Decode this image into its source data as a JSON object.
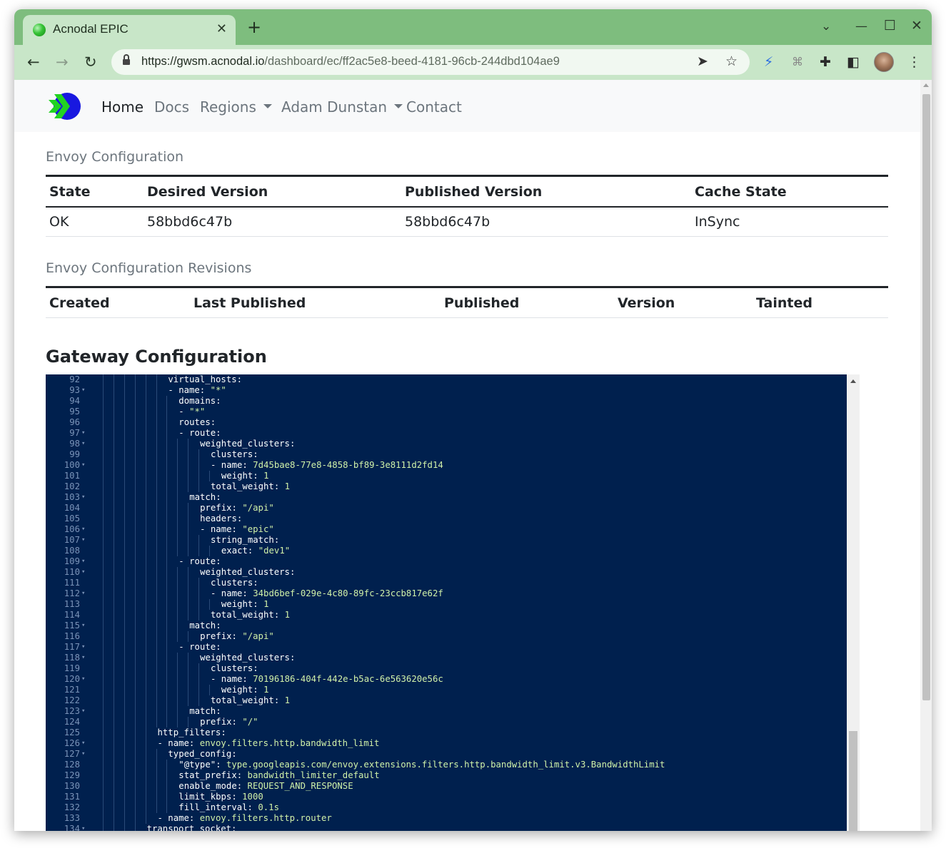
{
  "browser": {
    "tab_title": "Acnodal EPIC",
    "url_scheme_host": "https://gwsm.acnodal.io",
    "url_path": "/dashboard/ec/ff2ac5e8-beed-4181-96cb-244dbd104ae9"
  },
  "nav": {
    "home": "Home",
    "docs": "Docs",
    "regions": "Regions",
    "user": "Adam Dunstan",
    "contact": "Contact"
  },
  "envoy_config": {
    "title": "Envoy Configuration",
    "headers": [
      "State",
      "Desired Version",
      "Published Version",
      "Cache State"
    ],
    "row": [
      "OK",
      "58bbd6c47b",
      "58bbd6c47b",
      "InSync"
    ]
  },
  "revisions": {
    "title": "Envoy Configuration Revisions",
    "headers": [
      "Created",
      "Last Published",
      "Published",
      "Version",
      "Tainted"
    ]
  },
  "gateway": {
    "title": "Gateway Configuration",
    "lines": [
      {
        "n": "92",
        "fold": false,
        "indent": 12,
        "key": "virtual_hosts:",
        "val": ""
      },
      {
        "n": "93",
        "fold": true,
        "indent": 12,
        "key": "- name: ",
        "val": "\"*\""
      },
      {
        "n": "94",
        "fold": false,
        "indent": 14,
        "key": "domains:",
        "val": ""
      },
      {
        "n": "95",
        "fold": false,
        "indent": 14,
        "key": "- ",
        "val": "\"*\""
      },
      {
        "n": "96",
        "fold": false,
        "indent": 14,
        "key": "routes:",
        "val": ""
      },
      {
        "n": "97",
        "fold": true,
        "indent": 14,
        "key": "- route:",
        "val": ""
      },
      {
        "n": "98",
        "fold": true,
        "indent": 18,
        "key": "weighted_clusters:",
        "val": ""
      },
      {
        "n": "99",
        "fold": false,
        "indent": 20,
        "key": "clusters:",
        "val": ""
      },
      {
        "n": "100",
        "fold": true,
        "indent": 20,
        "key": "- name: ",
        "val": "7d45bae8-77e8-4858-bf89-3e8111d2fd14"
      },
      {
        "n": "101",
        "fold": false,
        "indent": 22,
        "key": "weight: ",
        "val": "1"
      },
      {
        "n": "102",
        "fold": false,
        "indent": 20,
        "key": "total_weight: ",
        "val": "1"
      },
      {
        "n": "103",
        "fold": true,
        "indent": 16,
        "key": "match:",
        "val": ""
      },
      {
        "n": "104",
        "fold": false,
        "indent": 18,
        "key": "prefix: ",
        "val": "\"/api\""
      },
      {
        "n": "105",
        "fold": false,
        "indent": 18,
        "key": "headers:",
        "val": ""
      },
      {
        "n": "106",
        "fold": true,
        "indent": 18,
        "key": "- name: ",
        "val": "\"epic\""
      },
      {
        "n": "107",
        "fold": true,
        "indent": 20,
        "key": "string_match:",
        "val": ""
      },
      {
        "n": "108",
        "fold": false,
        "indent": 22,
        "key": "exact: ",
        "val": "\"dev1\""
      },
      {
        "n": "109",
        "fold": true,
        "indent": 14,
        "key": "- route:",
        "val": ""
      },
      {
        "n": "110",
        "fold": true,
        "indent": 18,
        "key": "weighted_clusters:",
        "val": ""
      },
      {
        "n": "111",
        "fold": false,
        "indent": 20,
        "key": "clusters:",
        "val": ""
      },
      {
        "n": "112",
        "fold": true,
        "indent": 20,
        "key": "- name: ",
        "val": "34bd6bef-029e-4c80-89fc-23ccb817e62f"
      },
      {
        "n": "113",
        "fold": false,
        "indent": 22,
        "key": "weight: ",
        "val": "1"
      },
      {
        "n": "114",
        "fold": false,
        "indent": 20,
        "key": "total_weight: ",
        "val": "1"
      },
      {
        "n": "115",
        "fold": true,
        "indent": 16,
        "key": "match:",
        "val": ""
      },
      {
        "n": "116",
        "fold": false,
        "indent": 18,
        "key": "prefix: ",
        "val": "\"/api\""
      },
      {
        "n": "117",
        "fold": true,
        "indent": 14,
        "key": "- route:",
        "val": ""
      },
      {
        "n": "118",
        "fold": true,
        "indent": 18,
        "key": "weighted_clusters:",
        "val": ""
      },
      {
        "n": "119",
        "fold": false,
        "indent": 20,
        "key": "clusters:",
        "val": ""
      },
      {
        "n": "120",
        "fold": true,
        "indent": 20,
        "key": "- name: ",
        "val": "70196186-404f-442e-b5ac-6e563620e56c"
      },
      {
        "n": "121",
        "fold": false,
        "indent": 22,
        "key": "weight: ",
        "val": "1"
      },
      {
        "n": "122",
        "fold": false,
        "indent": 20,
        "key": "total_weight: ",
        "val": "1"
      },
      {
        "n": "123",
        "fold": true,
        "indent": 16,
        "key": "match:",
        "val": ""
      },
      {
        "n": "124",
        "fold": false,
        "indent": 18,
        "key": "prefix: ",
        "val": "\"/\""
      },
      {
        "n": "125",
        "fold": false,
        "indent": 10,
        "key": "http_filters:",
        "val": ""
      },
      {
        "n": "126",
        "fold": true,
        "indent": 10,
        "key": "- name: ",
        "val": "envoy.filters.http.bandwidth_limit"
      },
      {
        "n": "127",
        "fold": true,
        "indent": 12,
        "key": "typed_config:",
        "val": ""
      },
      {
        "n": "128",
        "fold": false,
        "indent": 14,
        "key": "\"@type\": ",
        "val": "type.googleapis.com/envoy.extensions.filters.http.bandwidth_limit.v3.BandwidthLimit"
      },
      {
        "n": "129",
        "fold": false,
        "indent": 14,
        "key": "stat_prefix: ",
        "val": "bandwidth_limiter_default"
      },
      {
        "n": "130",
        "fold": false,
        "indent": 14,
        "key": "enable_mode: ",
        "val": "REQUEST_AND_RESPONSE"
      },
      {
        "n": "131",
        "fold": false,
        "indent": 14,
        "key": "limit_kbps: ",
        "val": "1000"
      },
      {
        "n": "132",
        "fold": false,
        "indent": 14,
        "key": "fill_interval: ",
        "val": "0.1s"
      },
      {
        "n": "133",
        "fold": false,
        "indent": 10,
        "key": "- name: ",
        "val": "envoy.filters.http.router"
      },
      {
        "n": "134",
        "fold": true,
        "indent": 8,
        "key": "transport_socket:",
        "val": ""
      }
    ]
  },
  "colors": {
    "titlebar": "#7ebd7e",
    "toolbar": "#c8e6c8",
    "editor_bg": "#00204e",
    "editor_value": "#d1f1a9"
  }
}
